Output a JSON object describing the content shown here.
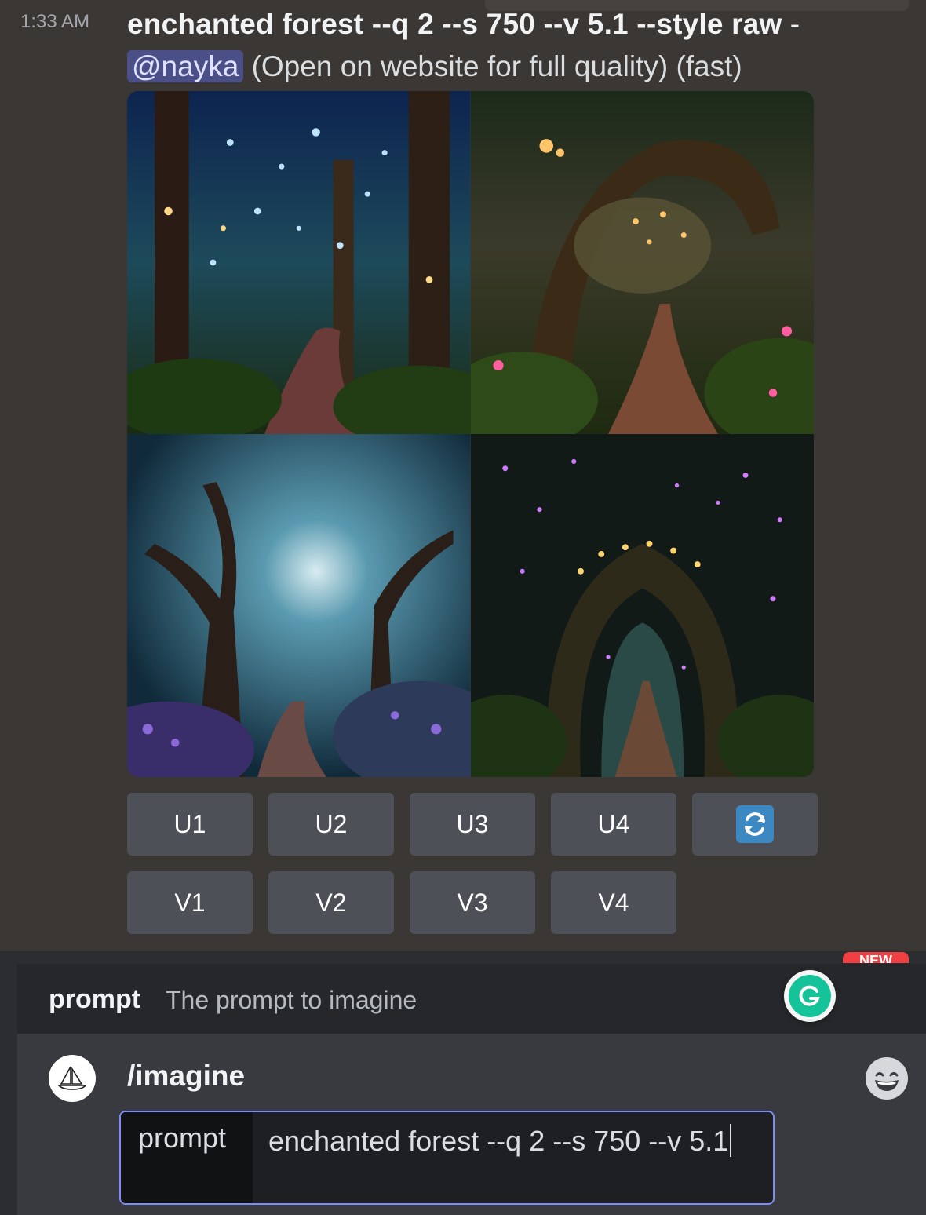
{
  "message": {
    "timestamp": "1:33 AM",
    "prompt_text": "enchanted forest --q 2 --s 750 --v 5.1 --style raw",
    "separator": " -",
    "mention": "@nayka",
    "meta_text": "(Open on website for full quality) (fast)"
  },
  "image_grid": {
    "tiles": [
      "blue-lit forest path",
      "golden lantern forest path",
      "blue moonlit forest path",
      "purple firefly archway path"
    ]
  },
  "buttons": {
    "upscale": [
      "U1",
      "U2",
      "U3",
      "U4"
    ],
    "variation": [
      "V1",
      "V2",
      "V3",
      "V4"
    ],
    "reroll_icon": "refresh-icon"
  },
  "composer": {
    "new_badge": "NEW",
    "hint_option_name": "prompt",
    "hint_option_desc": "The prompt to imagine",
    "command": "/imagine",
    "option_label": "prompt",
    "option_value": "enchanted forest --q 2 --s 750 --v 5.1"
  },
  "colors": {
    "background": "#3a3734",
    "button": "#4e5058",
    "mention_bg": "#4a4f87",
    "accent_border": "#7e8cf3",
    "grammarly": "#15c39a",
    "refresh_blue": "#3b88c3"
  }
}
